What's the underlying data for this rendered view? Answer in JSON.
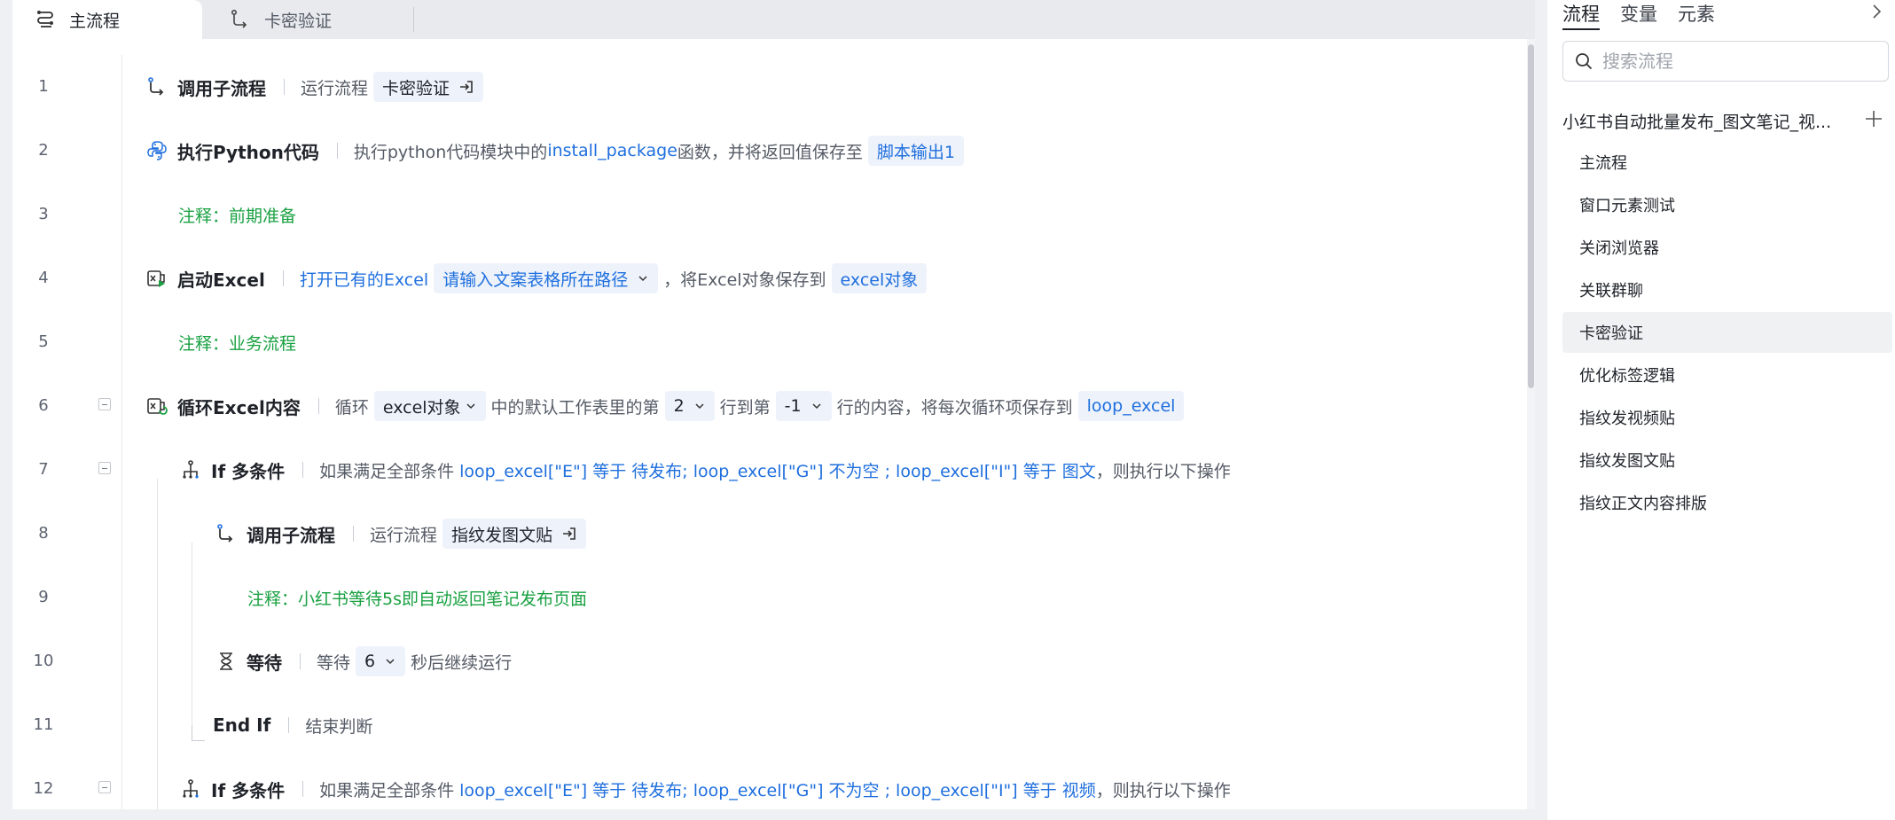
{
  "tabs": [
    {
      "label": "主流程",
      "icon": "flow-icon",
      "active": true
    },
    {
      "label": "卡密验证",
      "icon": "subflow-icon",
      "active": false
    }
  ],
  "lines": [
    {
      "n": "1",
      "title": "调用子流程",
      "pre": "运行流程",
      "chip": "卡密验证"
    },
    {
      "n": "2",
      "title": "执行Python代码",
      "t1": "执行python代码模块中的",
      "func": "install_package",
      "t2": "函数，并将返回值保存至",
      "chip": "脚本输出1"
    },
    {
      "n": "3",
      "comment": "注释：前期准备"
    },
    {
      "n": "4",
      "title": "启动Excel",
      "link": "打开已有的Excel",
      "chip": "请输入文案表格所在路径",
      "t1": "，将Excel对象保存到",
      "chip2": "excel对象"
    },
    {
      "n": "5",
      "comment": "注释：业务流程"
    },
    {
      "n": "6",
      "title": "循环Excel内容",
      "t1": "循环",
      "chip": "excel对象",
      "t2": "中的默认工作表里的第",
      "chip2": "2",
      "t3": "行到第",
      "chip3": "-1",
      "t4": "行的内容，将每次循环项保存到",
      "chip4": "loop_excel"
    },
    {
      "n": "7",
      "title": "If 多条件",
      "t1": "如果满足全部条件",
      "cond": "loop_excel[\"E\"] 等于 待发布; loop_excel[\"G\"] 不为空 ; loop_excel[\"I\"] 等于 图文",
      "t2": "，则执行以下操作"
    },
    {
      "n": "8",
      "title": "调用子流程",
      "pre": "运行流程",
      "chip": "指纹发图文贴"
    },
    {
      "n": "9",
      "comment": "注释：小红书等待5s即自动返回笔记发布页面"
    },
    {
      "n": "10",
      "title": "等待",
      "t1": "等待",
      "chip": "6",
      "t2": "秒后继续运行"
    },
    {
      "n": "11",
      "title": "End If",
      "t1": "结束判断"
    },
    {
      "n": "12",
      "title": "If 多条件",
      "t1": "如果满足全部条件",
      "cond": "loop_excel[\"E\"] 等于 待发布; loop_excel[\"G\"] 不为空 ; loop_excel[\"I\"] 等于 视频",
      "t2": "，则执行以下操作"
    }
  ],
  "right": {
    "tabs": [
      "流程",
      "变量",
      "元素"
    ],
    "search_placeholder": "搜索流程",
    "project_title": "小红书自动批量发布_图文笔记_视...",
    "flows": [
      "主流程",
      "窗口元素测试",
      "关闭浏览器",
      "关联群聊",
      "卡密验证",
      "优化标签逻辑",
      "指纹发视频贴",
      "指纹发图文贴",
      "指纹正文内容排版"
    ],
    "selected_flow": "卡密验证"
  },
  "colors": {
    "accent": "#1f6fde",
    "comment": "#1aa142",
    "chip_bg": "#eef3fb"
  }
}
